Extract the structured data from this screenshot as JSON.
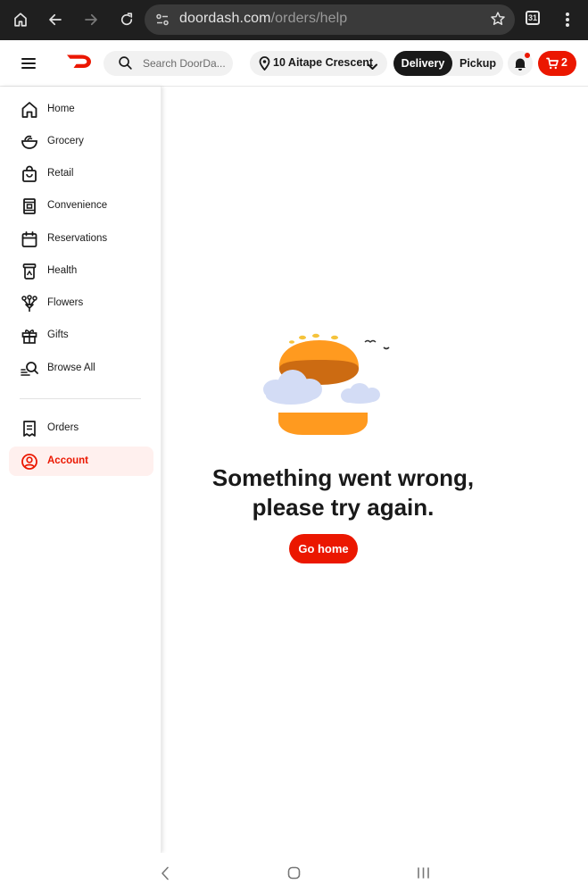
{
  "browser": {
    "url_host": "doordash.com",
    "url_path": "/orders/help",
    "tab_count": "31",
    "icons": [
      "home-icon",
      "back-icon",
      "forward-icon",
      "reload-icon",
      "site-settings-icon",
      "bookmark-star-icon",
      "tabs-icon",
      "more-vert-icon"
    ]
  },
  "header": {
    "search_placeholder": "Search DoorDa...",
    "address": "10 Aitape Crescent",
    "delivery_label": "Delivery",
    "pickup_label": "Pickup",
    "cart_count": "2",
    "brand_color": "#eb1700"
  },
  "sidebar": {
    "items": [
      {
        "label": "Home",
        "icon": "home-icon"
      },
      {
        "label": "Grocery",
        "icon": "grocery-bowl-icon"
      },
      {
        "label": "Retail",
        "icon": "shopping-bag-icon"
      },
      {
        "label": "Convenience",
        "icon": "convenience-store-icon"
      },
      {
        "label": "Reservations",
        "icon": "calendar-icon"
      },
      {
        "label": "Health",
        "icon": "health-icon"
      },
      {
        "label": "Flowers",
        "icon": "flowers-icon"
      },
      {
        "label": "Gifts",
        "icon": "gift-icon"
      },
      {
        "label": "Browse All",
        "icon": "browse-search-icon"
      }
    ],
    "secondary": [
      {
        "label": "Orders",
        "icon": "receipt-icon"
      },
      {
        "label": "Account",
        "icon": "account-icon",
        "active": true
      }
    ]
  },
  "main": {
    "error_line1": "Something went wrong,",
    "error_line2": "please try again.",
    "go_home_label": "Go home",
    "illustration": "burger-clouds-illustration"
  },
  "system_nav": {
    "icons": [
      "system-back-icon",
      "system-home-icon",
      "system-recents-icon"
    ]
  }
}
